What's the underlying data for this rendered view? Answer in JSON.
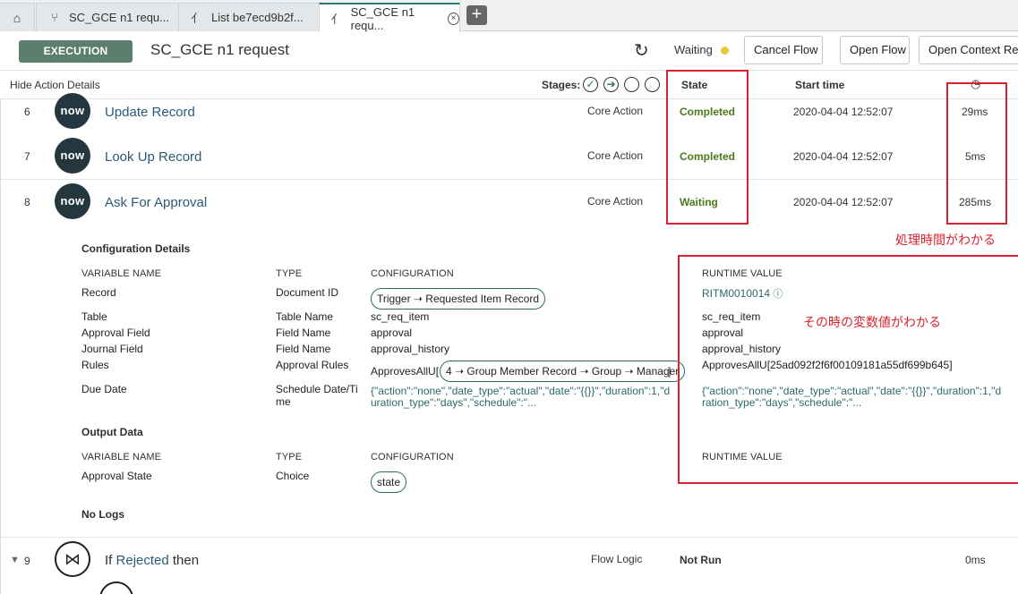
{
  "tabs": [
    {
      "label": "SC_GCE n1 requ...",
      "icon": "flow-icon"
    },
    {
      "label": "List be7ecd9b2f...",
      "icon": "pulse-icon"
    },
    {
      "label": "SC_GCE n1 requ...",
      "icon": "pulse-icon",
      "close": "⊗"
    }
  ],
  "header": {
    "badge": "EXECUTION DETAILS",
    "title": "SC_GCE n1 request",
    "status": "Waiting",
    "cancel_flow": "Cancel Flow",
    "open_flow": "Open Flow",
    "open_context": "Open Context Reco"
  },
  "table_header": {
    "hide_action": "Hide Action Details",
    "stages_label": "Stages:",
    "state": "State",
    "start_time": "Start time"
  },
  "rows": [
    {
      "num": "6",
      "title": "Update Record",
      "type": "Core Action",
      "state": "Completed",
      "start": "2020-04-04 12:52:07",
      "duration": "29ms",
      "logo": "now"
    },
    {
      "num": "7",
      "title": "Look Up Record",
      "type": "Core Action",
      "state": "Completed",
      "start": "2020-04-04 12:52:07",
      "duration": "5ms",
      "logo": "now"
    },
    {
      "num": "8",
      "title": "Ask For Approval",
      "type": "Core Action",
      "state": "Waiting",
      "start": "2020-04-04 12:52:07",
      "duration": "285ms",
      "logo": "now"
    }
  ],
  "config": {
    "section": "Configuration Details",
    "col_var": "VARIABLE NAME",
    "col_type": "TYPE",
    "col_cfg": "CONFIGURATION",
    "col_runtime": "RUNTIME VALUE",
    "items": [
      {
        "name": "Record",
        "type": "Document ID",
        "cfg": "Trigger ➝ Requested Item Record",
        "runtime": "RITM0010014"
      },
      {
        "name": "Table",
        "type": "Table Name",
        "cfg": "sc_req_item",
        "runtime": "sc_req_item"
      },
      {
        "name": "Approval Field",
        "type": "Field Name",
        "cfg": "approval",
        "runtime": "approval"
      },
      {
        "name": "Journal Field",
        "type": "Field Name",
        "cfg": "approval_history",
        "runtime": "approval_history"
      },
      {
        "name": "Rules",
        "type": "Approval Rules",
        "cfg_prefix": "ApprovesAllU[",
        "cfg_pill": "4 ➝ Group Member Record ➝ Group ➝ Manager",
        "cfg_suffix": "]",
        "runtime": "ApprovesAllU[25ad092f2f6f00109181a55df699b645]"
      },
      {
        "name": "Due Date",
        "type_line1": "Schedule Date/Ti",
        "type_line2": "me",
        "cfg_line1": "{\"action\":\"none\",\"date_type\":\"actual\",\"date\":\"{{}}\",\"duration\":1,\"d",
        "cfg_line2": "uration_type\":\"days\",\"schedule\":\"...",
        "runtime_line1": "{\"action\":\"none\",\"date_type\":\"actual\",\"date\":\"{{}}\",\"duration\":1,\"d",
        "runtime_line2": "ration_type\":\"days\",\"schedule\":\"..."
      }
    ]
  },
  "output": {
    "section": "Output Data",
    "col_var": "VARIABLE NAME",
    "col_type": "TYPE",
    "col_cfg": "CONFIGURATION",
    "col_runtime": "RUNTIME VALUE",
    "name": "Approval State",
    "type": "Choice",
    "cfg": "state"
  },
  "no_logs": "No Logs",
  "row9": {
    "num": "9",
    "prefix": "If ",
    "link": "Rejected",
    "suffix": " then",
    "type": "Flow Logic",
    "state": "Not Run",
    "duration": "0ms"
  },
  "annotations": {
    "time": "処理時間がわかる",
    "vars": "その時の変数値がわかる"
  },
  "colors": {
    "accent": "#2c6a68",
    "badge": "#5c7f6d",
    "status_dot": "#e8c93a",
    "annotation": "#d9232d",
    "completed": "#4a7a1a"
  }
}
